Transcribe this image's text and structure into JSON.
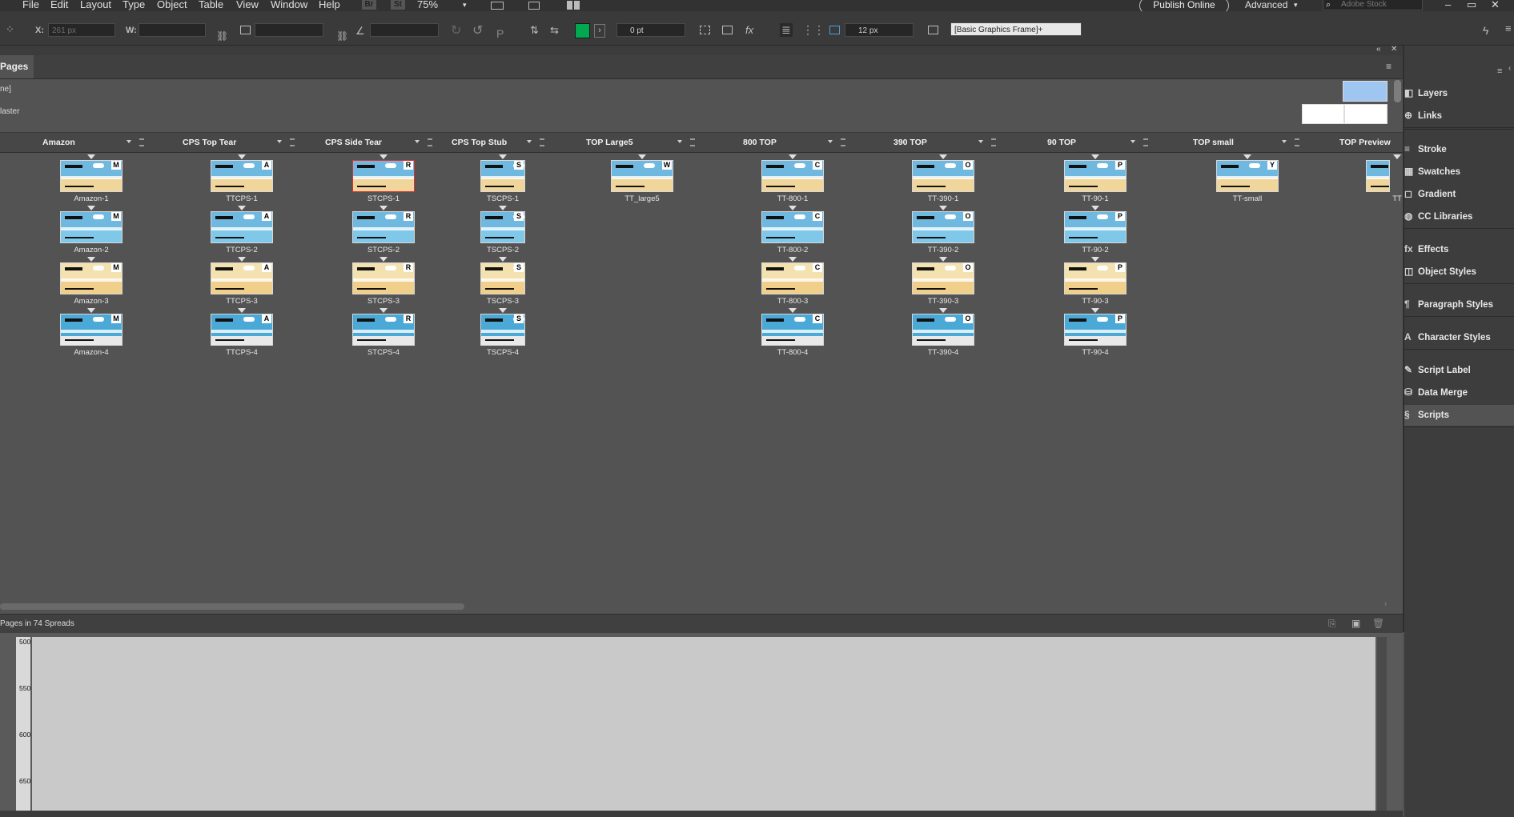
{
  "menubar": {
    "items": [
      "File",
      "Edit",
      "Layout",
      "Type",
      "Object",
      "Table",
      "View",
      "Window",
      "Help"
    ],
    "bridge": "Br",
    "stock": "St",
    "zoom": "75%",
    "publish": "Publish Online",
    "workspace": "Advanced",
    "search_placeholder": "Adobe Stock"
  },
  "controlbar": {
    "x_label": "X:",
    "x_value": "261 px",
    "w_label": "W:",
    "stroke_weight": "0 pt",
    "gap_value": "12 px",
    "object_style": "[Basic Graphics Frame]+",
    "fill_color": "#00a84f"
  },
  "pages_panel": {
    "tab_label": "Pages",
    "master_none": "ne]",
    "master_label": "laster",
    "footer_text": "Pages in 74 Spreads",
    "columns": [
      "Amazon",
      "CPS Top Tear",
      "CPS Side Tear",
      "CPS Top Stub",
      "TOP Large5",
      "800 TOP",
      "390 TOP",
      "90 TOP",
      "TOP small",
      "TOP Preview"
    ],
    "pages": [
      {
        "col": 0,
        "row": 0,
        "label": "Amazon-1",
        "letter": "M"
      },
      {
        "col": 0,
        "row": 1,
        "label": "Amazon-2",
        "letter": "M"
      },
      {
        "col": 0,
        "row": 2,
        "label": "Amazon-3",
        "letter": "M"
      },
      {
        "col": 0,
        "row": 3,
        "label": "Amazon-4",
        "letter": "M"
      },
      {
        "col": 1,
        "row": 0,
        "label": "TTCPS-1",
        "letter": "A"
      },
      {
        "col": 1,
        "row": 1,
        "label": "TTCPS-2",
        "letter": "A"
      },
      {
        "col": 1,
        "row": 2,
        "label": "TTCPS-3",
        "letter": "A"
      },
      {
        "col": 1,
        "row": 3,
        "label": "TTCPS-4",
        "letter": "A"
      },
      {
        "col": 2,
        "row": 0,
        "label": "STCPS-1",
        "letter": "R"
      },
      {
        "col": 2,
        "row": 1,
        "label": "STCPS-2",
        "letter": "R"
      },
      {
        "col": 2,
        "row": 2,
        "label": "STCPS-3",
        "letter": "R"
      },
      {
        "col": 2,
        "row": 3,
        "label": "STCPS-4",
        "letter": "R"
      },
      {
        "col": 3,
        "row": 0,
        "label": "TSCPS-1",
        "letter": "S"
      },
      {
        "col": 3,
        "row": 1,
        "label": "TSCPS-2",
        "letter": "S"
      },
      {
        "col": 3,
        "row": 2,
        "label": "TSCPS-3",
        "letter": "S"
      },
      {
        "col": 3,
        "row": 3,
        "label": "TSCPS-4",
        "letter": "S"
      },
      {
        "col": 4,
        "row": 0,
        "label": "TT_large5",
        "letter": "W"
      },
      {
        "col": 5,
        "row": 0,
        "label": "TT-800-1",
        "letter": "C"
      },
      {
        "col": 5,
        "row": 1,
        "label": "TT-800-2",
        "letter": "C"
      },
      {
        "col": 5,
        "row": 2,
        "label": "TT-800-3",
        "letter": "C"
      },
      {
        "col": 5,
        "row": 3,
        "label": "TT-800-4",
        "letter": "C"
      },
      {
        "col": 6,
        "row": 0,
        "label": "TT-390-1",
        "letter": "O"
      },
      {
        "col": 6,
        "row": 1,
        "label": "TT-390-2",
        "letter": "O"
      },
      {
        "col": 6,
        "row": 2,
        "label": "TT-390-3",
        "letter": "O"
      },
      {
        "col": 6,
        "row": 3,
        "label": "TT-390-4",
        "letter": "O"
      },
      {
        "col": 7,
        "row": 0,
        "label": "TT-90-1",
        "letter": "P"
      },
      {
        "col": 7,
        "row": 1,
        "label": "TT-90-2",
        "letter": "P"
      },
      {
        "col": 7,
        "row": 2,
        "label": "TT-90-3",
        "letter": "P"
      },
      {
        "col": 7,
        "row": 3,
        "label": "TT-90-4",
        "letter": "P"
      },
      {
        "col": 8,
        "row": 0,
        "label": "TT-small",
        "letter": "Y"
      },
      {
        "col": 9,
        "row": 0,
        "label": "TT",
        "letter": ""
      }
    ]
  },
  "dock": {
    "items": [
      {
        "label": "Layers",
        "icon": "layers-icon",
        "glyph": "◧"
      },
      {
        "label": "Links",
        "icon": "links-icon",
        "glyph": "⊕"
      },
      {
        "label": "Stroke",
        "icon": "stroke-icon",
        "glyph": "≡"
      },
      {
        "label": "Swatches",
        "icon": "swatches-icon",
        "glyph": "▦"
      },
      {
        "label": "Gradient",
        "icon": "gradient-icon",
        "glyph": "◻"
      },
      {
        "label": "CC Libraries",
        "icon": "cc-libraries-icon",
        "glyph": "◍"
      },
      {
        "label": "Effects",
        "icon": "effects-icon",
        "glyph": "fx"
      },
      {
        "label": "Object Styles",
        "icon": "object-styles-icon",
        "glyph": "◫"
      },
      {
        "label": "Paragraph Styles",
        "icon": "paragraph-styles-icon",
        "glyph": "¶"
      },
      {
        "label": "Character Styles",
        "icon": "character-styles-icon",
        "glyph": "A"
      },
      {
        "label": "Script Label",
        "icon": "script-label-icon",
        "glyph": "✎"
      },
      {
        "label": "Data Merge",
        "icon": "data-merge-icon",
        "glyph": "⛁"
      },
      {
        "label": "Scripts",
        "icon": "scripts-icon",
        "glyph": "§"
      }
    ]
  },
  "ruler": {
    "ticks": [
      "500",
      "550",
      "600",
      "650"
    ]
  }
}
